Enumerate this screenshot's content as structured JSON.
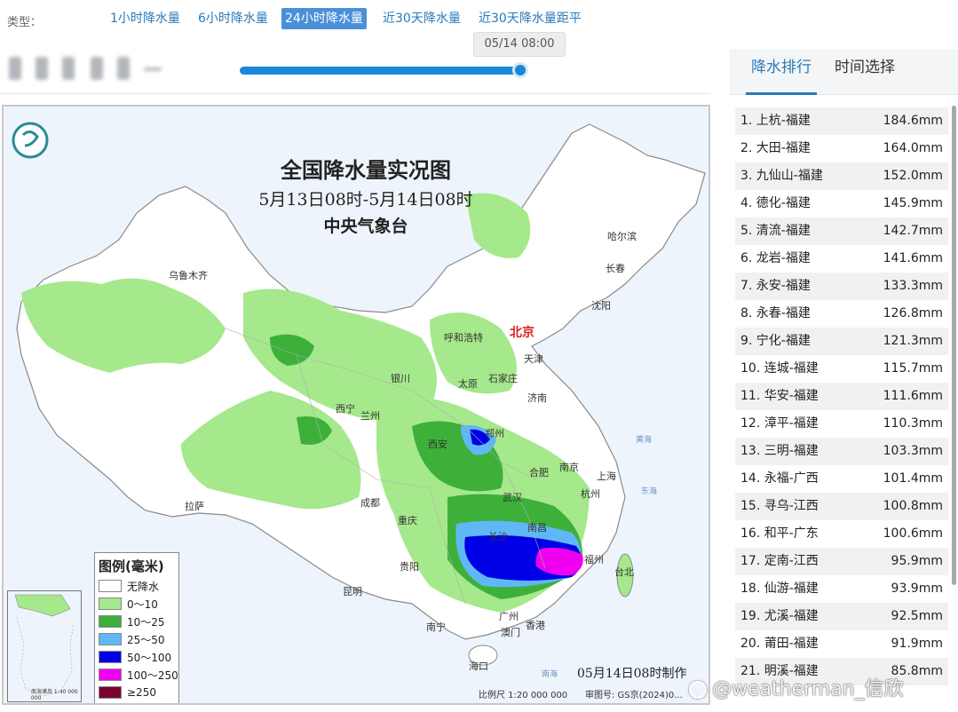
{
  "type_bar": {
    "label": "类型：",
    "tabs": [
      {
        "label": "1小时降水量",
        "active": false
      },
      {
        "label": "6小时降水量",
        "active": false
      },
      {
        "label": "24小时降水量",
        "active": true
      },
      {
        "label": "近30天降水量",
        "active": false
      },
      {
        "label": "近30天降水量距平",
        "active": false
      }
    ]
  },
  "timeline": {
    "current": "05/14 08:00",
    "progress": 1.0
  },
  "map": {
    "title": "全国降水量实况图",
    "period": "5月13日08时-5月14日08时",
    "agency": "中央气象台",
    "legend_title": "图例(毫米)",
    "legend": [
      {
        "label": "无降水",
        "color": "#ffffff"
      },
      {
        "label": "0～10",
        "color": "#a6e88c"
      },
      {
        "label": "10～25",
        "color": "#3db03a"
      },
      {
        "label": "25～50",
        "color": "#5fb8f5"
      },
      {
        "label": "50～100",
        "color": "#0000e6"
      },
      {
        "label": "100～250",
        "color": "#f000f0"
      },
      {
        "label": "≥250",
        "color": "#7a0030"
      }
    ],
    "cities": [
      "乌鲁木齐",
      "哈尔滨",
      "长春",
      "沈阳",
      "北京",
      "天津",
      "呼和浩特",
      "石家庄",
      "太原",
      "济南",
      "银川",
      "西宁",
      "兰州",
      "郑州",
      "西安",
      "合肥",
      "南京",
      "上海",
      "杭州",
      "武汉",
      "成都",
      "重庆",
      "拉萨",
      "长沙",
      "南昌",
      "福州",
      "台北",
      "贵阳",
      "昆明",
      "广州",
      "香港",
      "澳门",
      "南宁",
      "海口"
    ],
    "seas": [
      "黄海",
      "东海",
      "南海"
    ],
    "made": "05月14日08时制作",
    "scale": "比例尺 1:20 000 000",
    "approval": "审图号: GS京(2024)0...",
    "inset_scale": "南海诸岛 1:40 000 000"
  },
  "watermark": "@weatherman_信欣",
  "right_panel": {
    "tabs": [
      {
        "label": "降水排行",
        "active": true
      },
      {
        "label": "时间选择",
        "active": false
      }
    ],
    "ranking": [
      {
        "name": "1. 上杭-福建",
        "value": "184.6mm"
      },
      {
        "name": "2. 大田-福建",
        "value": "164.0mm"
      },
      {
        "name": "3. 九仙山-福建",
        "value": "152.0mm"
      },
      {
        "name": "4. 德化-福建",
        "value": "145.9mm"
      },
      {
        "name": "5. 清流-福建",
        "value": "142.7mm"
      },
      {
        "name": "6. 龙岩-福建",
        "value": "141.6mm"
      },
      {
        "name": "7. 永安-福建",
        "value": "133.3mm"
      },
      {
        "name": "8. 永春-福建",
        "value": "126.8mm"
      },
      {
        "name": "9. 宁化-福建",
        "value": "121.3mm"
      },
      {
        "name": "10. 连城-福建",
        "value": "115.7mm"
      },
      {
        "name": "11. 华安-福建",
        "value": "111.6mm"
      },
      {
        "name": "12. 漳平-福建",
        "value": "110.3mm"
      },
      {
        "name": "13. 三明-福建",
        "value": "103.3mm"
      },
      {
        "name": "14. 永福-广西",
        "value": "101.4mm"
      },
      {
        "name": "15. 寻乌-江西",
        "value": "100.8mm"
      },
      {
        "name": "16. 和平-广东",
        "value": "100.6mm"
      },
      {
        "name": "17. 定南-江西",
        "value": "95.9mm"
      },
      {
        "name": "18. 仙游-福建",
        "value": "93.9mm"
      },
      {
        "name": "19. 尤溪-福建",
        "value": "92.5mm"
      },
      {
        "name": "20. 莆田-福建",
        "value": "91.9mm"
      },
      {
        "name": "21. 明溪-福建",
        "value": "85.8mm"
      }
    ]
  }
}
